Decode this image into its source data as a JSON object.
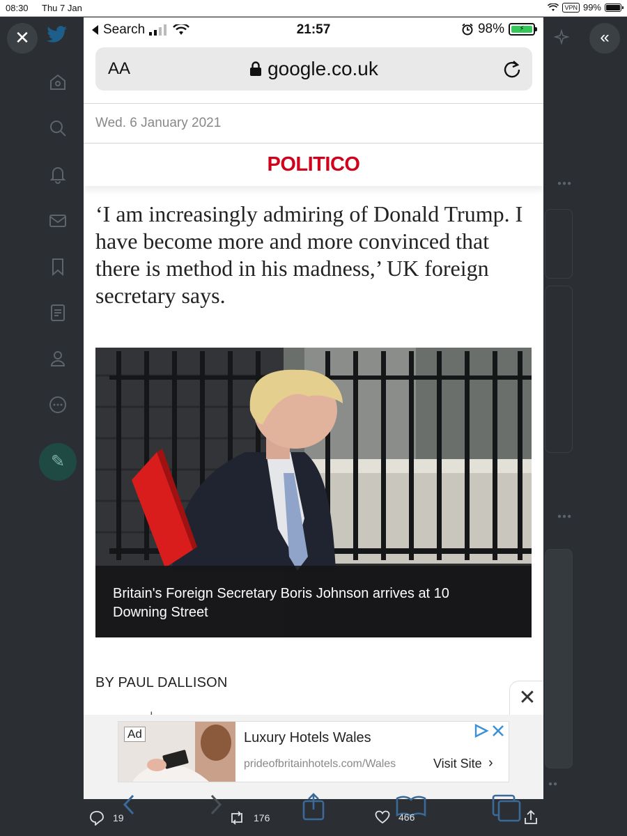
{
  "ipad_status": {
    "time": "08:30",
    "date": "Thu 7 Jan",
    "vpn": "VPN",
    "battery": "99%"
  },
  "phone": {
    "status": {
      "back_label": "Search",
      "time": "21:57",
      "battery": "98%"
    },
    "url_bar": {
      "text_size": "AA",
      "domain": "google.co.uk"
    },
    "date": "Wed. 6 January 2021",
    "logo": "POLITICO",
    "headline": "‘I am increasingly admiring of Donald Trump. I have become more and more convinced that there is method in his madness,’ UK foreign secretary says.",
    "photo_caption": "Britain's Foreign Secretary Boris Johnson arrives at 10 Downing Street",
    "byline": "BY PAUL DALLISON",
    "ad": {
      "tag": "Ad",
      "title": "Luxury Hotels Wales",
      "url": "prideofbritainhotels.com/Wales",
      "cta": "Visit Site"
    }
  },
  "tweet_actions": {
    "replies": "19",
    "retweets": "176",
    "likes": "466"
  }
}
